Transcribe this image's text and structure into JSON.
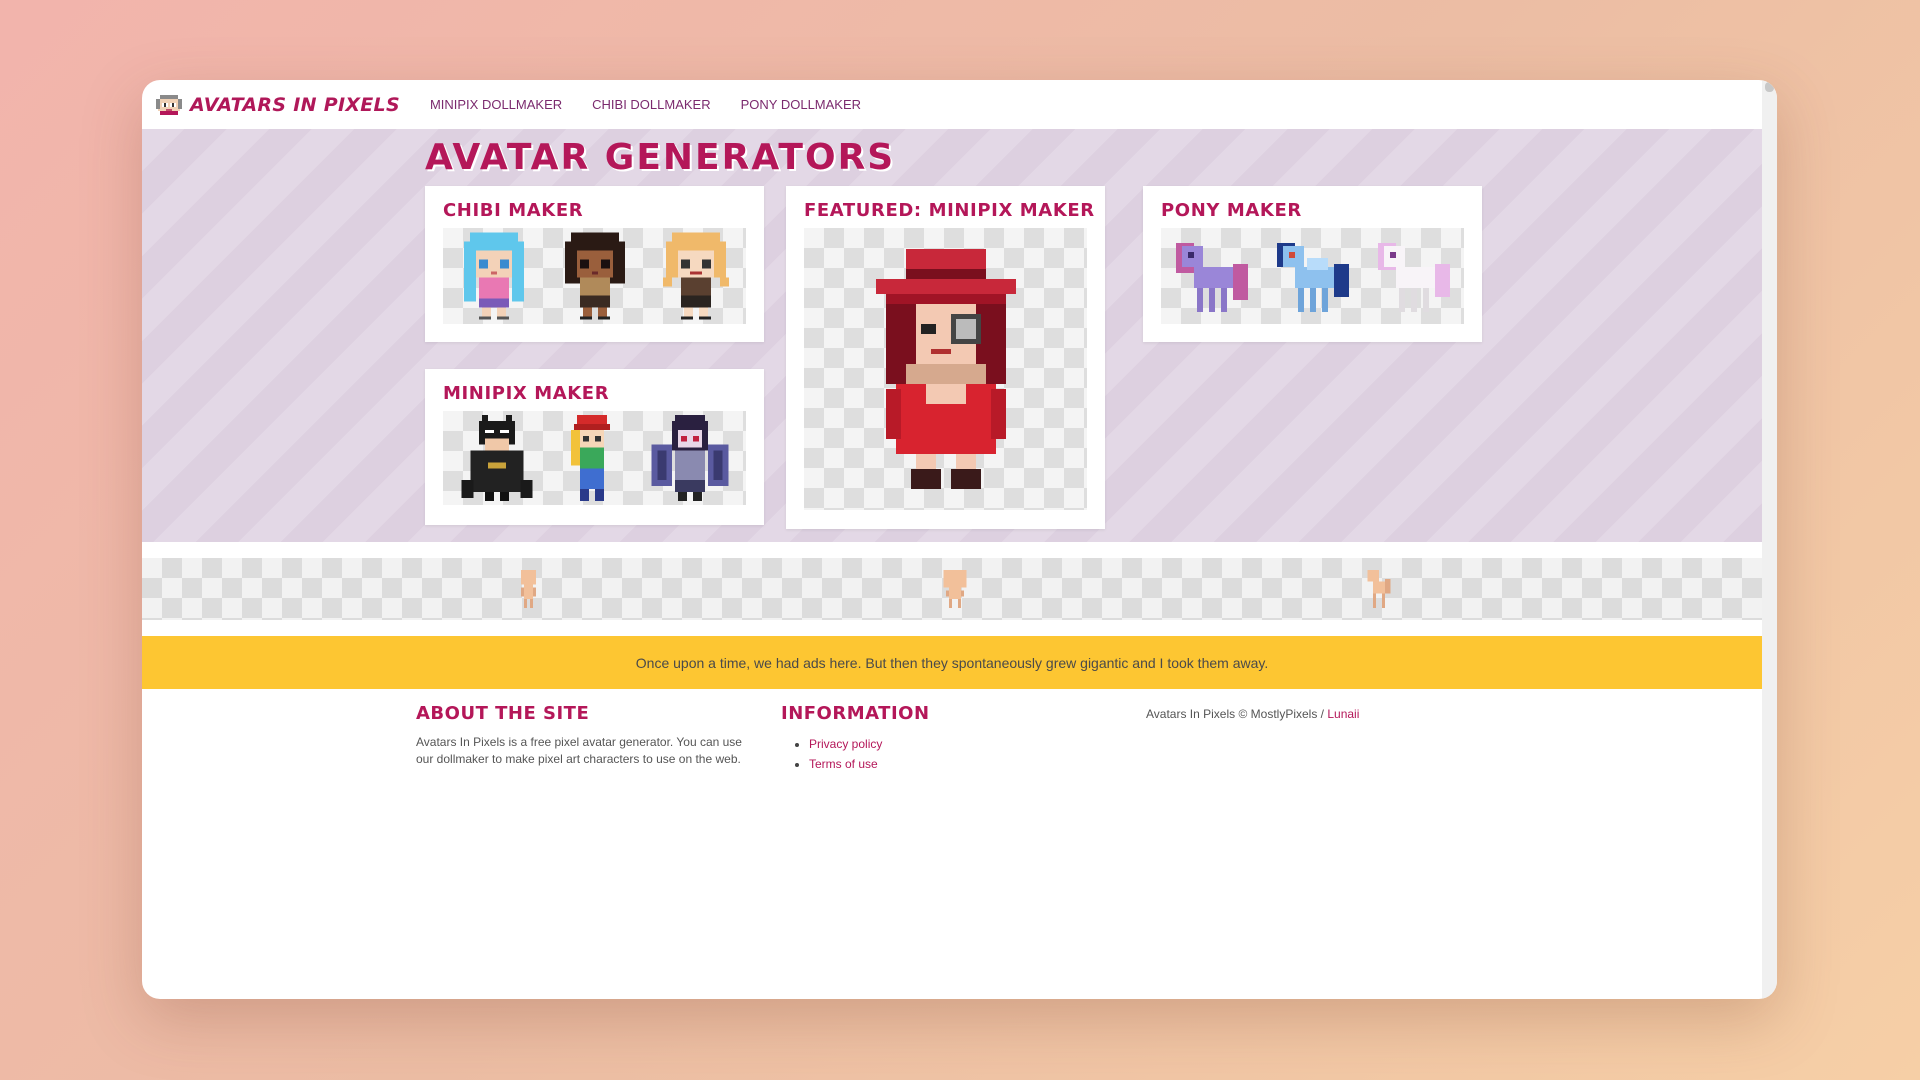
{
  "site": {
    "brand": "AVATARS IN PIXELS",
    "logo_icon": "pixel-avatar-face-icon"
  },
  "nav": {
    "links": [
      "MINIPIX DOLLMAKER",
      "CHIBI DOLLMAKER",
      "PONY DOLLMAKER"
    ]
  },
  "hero": {
    "title": "AVATAR GENERATORS",
    "cards": {
      "chibi": {
        "title": "CHIBI MAKER"
      },
      "minipix": {
        "title": "MINIPIX MAKER"
      },
      "featured": {
        "title": "FEATURED: MINIPIX MAKER"
      },
      "pony": {
        "title": "PONY MAKER"
      }
    }
  },
  "banner": {
    "text": "Once upon a time, we had ads here. But then they spontaneously grew gigantic and I took them away."
  },
  "footer": {
    "about": {
      "title": "ABOUT THE SITE",
      "text": "Avatars In Pixels is a free pixel avatar generator. You can use our dollmaker to make pixel art characters to use on the web."
    },
    "info": {
      "title": "INFORMATION",
      "links": [
        "Privacy policy",
        "Terms of use"
      ]
    },
    "copyright": "Avatars In Pixels © MostlyPixels / ",
    "copyright_link": "Lunaii"
  },
  "colors": {
    "accent": "#b41759",
    "nav_link": "#7b2a6e",
    "hero_bg": "#ddd0e0",
    "banner_bg": "#fdc632"
  }
}
